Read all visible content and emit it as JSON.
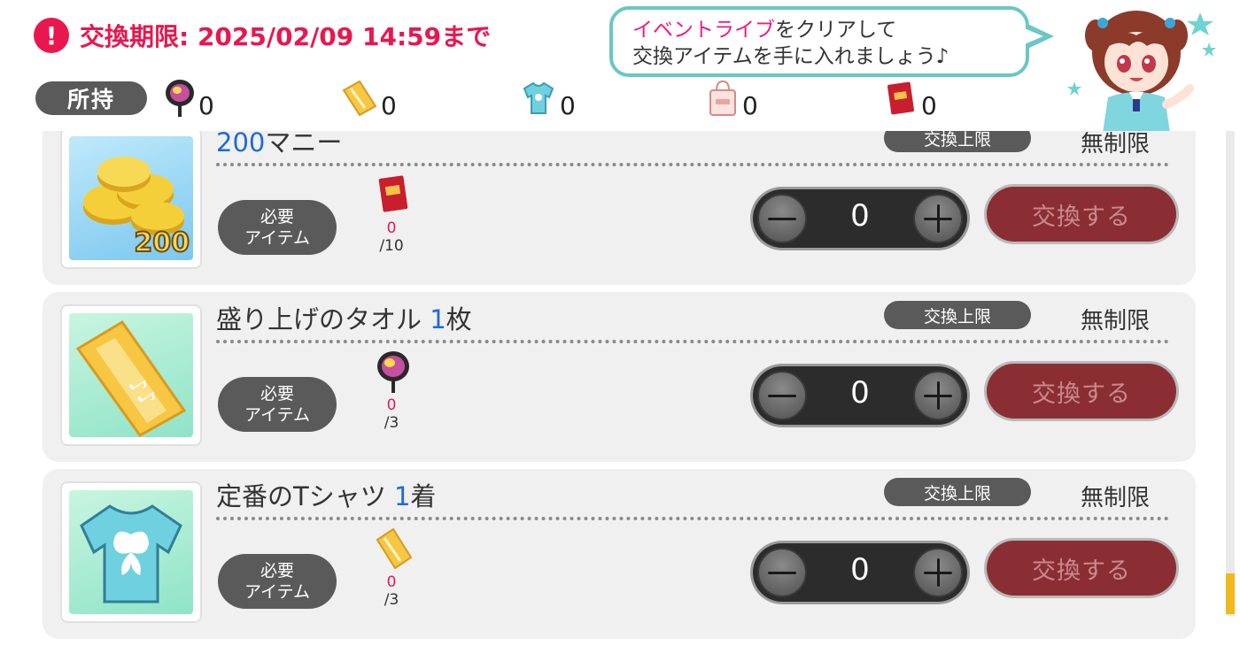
{
  "header": {
    "alert_icon": "exclamation-circle-icon",
    "deadline_text": "交換期限: 2025/02/09 14:59まで",
    "speech_bubble": {
      "highlight": "イベントライブ",
      "line1_rest": "をクリアして",
      "line2": "交換アイテムを手に入れましょう♪"
    }
  },
  "owned": {
    "label": "所持",
    "items": [
      {
        "icon": "uchiwa-fan-icon",
        "count": "0"
      },
      {
        "icon": "towel-icon",
        "count": "0"
      },
      {
        "icon": "tshirt-icon",
        "count": "0"
      },
      {
        "icon": "shopping-bag-icon",
        "count": "0"
      },
      {
        "icon": "booklet-icon",
        "count": "0"
      }
    ]
  },
  "exchange_items": [
    {
      "name_num": "200",
      "name_text": "マニー",
      "name_suffix": "",
      "image_icon": "gold-coins-icon",
      "image_label": "200",
      "limit_label": "交換上限",
      "limit_value": "無制限",
      "required_label_1": "必要",
      "required_label_2": "アイテム",
      "required_icon": "booklet-icon",
      "required_have": "0",
      "required_need": "/10",
      "quantity": "0",
      "exchange_label": "交換する"
    },
    {
      "name_num": "",
      "name_text": "盛り上げのタオル ",
      "name_qty": "1",
      "name_suffix": "枚",
      "image_icon": "towel-icon",
      "limit_label": "交換上限",
      "limit_value": "無制限",
      "required_label_1": "必要",
      "required_label_2": "アイテム",
      "required_icon": "uchiwa-fan-icon",
      "required_have": "0",
      "required_need": "/3",
      "quantity": "0",
      "exchange_label": "交換する"
    },
    {
      "name_num": "",
      "name_text": "定番のTシャツ ",
      "name_qty": "1",
      "name_suffix": "着",
      "image_icon": "tshirt-icon",
      "limit_label": "交換上限",
      "limit_value": "無制限",
      "required_label_1": "必要",
      "required_label_2": "アイテム",
      "required_icon": "towel-icon",
      "required_have": "0",
      "required_need": "/3",
      "quantity": "0",
      "exchange_label": "交換する"
    }
  ],
  "colors": {
    "accent_pink": "#e8174f",
    "bubble_border": "#69c7c4",
    "exchange_button": "#8b2e33",
    "number_blue": "#1f6ad9"
  }
}
